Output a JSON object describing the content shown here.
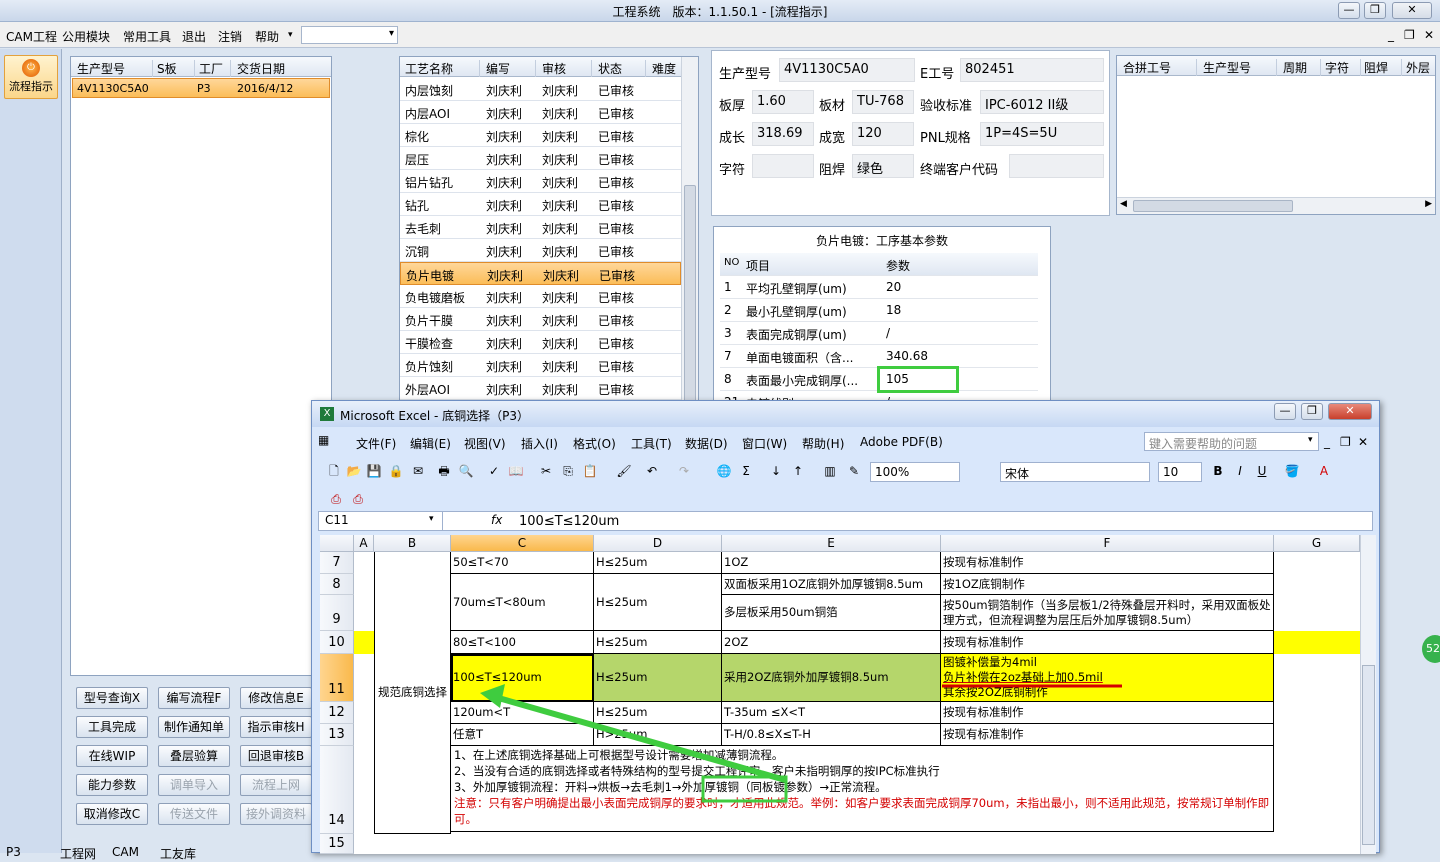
{
  "window": {
    "title": "工程系统　版本：1.1.50.1 - [流程指示]"
  },
  "menu": {
    "items": [
      "CAM工程",
      "公用模块",
      "常用工具",
      "退出",
      "注销",
      "帮助"
    ]
  },
  "nav": {
    "flow_label": "流程指示"
  },
  "orders": {
    "headers": [
      "生产型号",
      "S板",
      "工厂",
      "交货日期"
    ],
    "rows": [
      {
        "model": "4V1130C5A0",
        "s": "",
        "factory": "P3",
        "date": "2016/4/12"
      }
    ]
  },
  "process": {
    "headers": [
      "工艺名称",
      "编写",
      "审核",
      "状态",
      "难度"
    ],
    "rows": [
      [
        "内层蚀刻",
        "刘庆利",
        "刘庆利",
        "已审核"
      ],
      [
        "内层AOI",
        "刘庆利",
        "刘庆利",
        "已审核"
      ],
      [
        "棕化",
        "刘庆利",
        "刘庆利",
        "已审核"
      ],
      [
        "层压",
        "刘庆利",
        "刘庆利",
        "已审核"
      ],
      [
        "铝片钻孔",
        "刘庆利",
        "刘庆利",
        "已审核"
      ],
      [
        "钻孔",
        "刘庆利",
        "刘庆利",
        "已审核"
      ],
      [
        "去毛刺",
        "刘庆利",
        "刘庆利",
        "已审核"
      ],
      [
        "沉铜",
        "刘庆利",
        "刘庆利",
        "已审核"
      ],
      [
        "负片电镀",
        "刘庆利",
        "刘庆利",
        "已审核"
      ],
      [
        "负电镀磨板",
        "刘庆利",
        "刘庆利",
        "已审核"
      ],
      [
        "负片干膜",
        "刘庆利",
        "刘庆利",
        "已审核"
      ],
      [
        "干膜检查",
        "刘庆利",
        "刘庆利",
        "已审核"
      ],
      [
        "负片蚀刻",
        "刘庆利",
        "刘庆利",
        "已审核"
      ],
      [
        "外层AOI",
        "刘庆利",
        "刘庆利",
        "已审核"
      ]
    ]
  },
  "info": {
    "model_label": "生产型号",
    "model": "4V1130C5A0",
    "eno_label": "E工号",
    "eno": "802451",
    "thick_label": "板厚",
    "thick": "1.60",
    "mat_label": "板材",
    "mat": "TU-768",
    "std_label": "验收标准",
    "std": "IPC-6012 II级",
    "len_label": "成长",
    "len": "318.69",
    "wid_label": "成宽",
    "wid": "120",
    "pnl_label": "PNL规格",
    "pnl": "1P=4S=5U",
    "char_label": "字符",
    "char": "",
    "mask_label": "阻焊",
    "mask": "绿色",
    "cust_label": "终端客户代码",
    "cust": ""
  },
  "panels": {
    "headers": [
      "合拼工号",
      "生产型号",
      "周期",
      "字符",
      "阻焊",
      "外层"
    ]
  },
  "param": {
    "title": "负片电镀：工序基本参数",
    "headers": [
      "NO",
      "项目",
      "参数"
    ],
    "rows": [
      [
        "1",
        "平均孔壁铜厚(um)",
        "20"
      ],
      [
        "2",
        "最小孔壁铜厚(um)",
        "18"
      ],
      [
        "3",
        "表面完成铜厚(um)",
        "/"
      ],
      [
        "7",
        "单面电镀面积（含...",
        "340.68"
      ],
      [
        "8",
        "表面最小完成铜厚(...",
        "105"
      ],
      [
        "21",
        "电镀线别",
        "/"
      ]
    ]
  },
  "buttons": {
    "row1": [
      "型号查询X",
      "编写流程F",
      "修改信息E"
    ],
    "row2": [
      "工具完成",
      "制作通知单",
      "指示审核H"
    ],
    "row3": [
      "在线WIP",
      "叠层验算",
      "回退审核B"
    ],
    "row4": [
      "能力参数",
      "调单导入",
      "流程上网"
    ],
    "row5": [
      "取消修改C",
      "传送文件",
      "接外调资料"
    ]
  },
  "status_tabs": [
    "P3",
    "工程网",
    "CAM",
    "工友库"
  ],
  "excel": {
    "title": "Microsoft Excel - 底铜选择（P3）",
    "menu": [
      "文件(F)",
      "编辑(E)",
      "视图(V)",
      "插入(I)",
      "格式(O)",
      "工具(T)",
      "数据(D)",
      "窗口(W)",
      "帮助(H)",
      "Adobe PDF(B)"
    ],
    "help_placeholder": "键入需要帮助的问题",
    "zoom": "100%",
    "font": "宋体",
    "font_size": "10",
    "name_box": "C11",
    "formula": "100≤T≤120um",
    "columns": [
      "A",
      "B",
      "C",
      "D",
      "E",
      "F",
      "G"
    ],
    "row_numbers": [
      "7",
      "8",
      "9",
      "10",
      "11",
      "12",
      "13",
      "14",
      "15"
    ],
    "b_label": "规范底铜选择",
    "cells": {
      "c7": "50≤T<70",
      "d7": "H≤25um",
      "e7": "1OZ",
      "f7": "按现有标准制作",
      "e8": "双面板采用1OZ底铜外加厚镀铜8.5um",
      "f8": "按1OZ底铜制作",
      "c9": "70um≤T<80um",
      "d9": "H≤25um",
      "e9": "多层板采用50um铜箔",
      "f9": "按50um铜箔制作（当多层板1/2待殊叠层开料时，采用双面板处理方式，但流程调整为层压后外加厚镀铜8.5um）",
      "c10": "80≤T<100",
      "d10": "H≤25um",
      "e10": "2OZ",
      "f10": "按现有标准制作",
      "c11": "100≤T≤120um",
      "d11": "H≤25um",
      "e11": "采用2OZ底铜外加厚镀铜8.5um",
      "f11a": "图镀补偿量为4mil",
      "f11b": "负片补偿在2oz基础上加0.5mil",
      "f11c": "其余按2OZ底铜制作",
      "c12": "120um<T",
      "d12": "H≤25um",
      "e12": "T-35um ≤X<T",
      "f12": "按现有标准制作",
      "c13": "任意T",
      "d13": "H>25um",
      "e13": "T-H/0.8≤X≤T-H",
      "f13": "按现有标准制作"
    },
    "notes": [
      "1、在上述底铜选择基础上可根据型号设计需要增加减薄铜流程。",
      "2、当没有合适的底铜选择或者特殊结构的型号提交工程评审，客户未指明铜厚的按IPC标准执行",
      "3、外加厚镀铜流程：开料→烘板→去毛刺1→外加厚镀铜（同板镀参数）→正常流程。",
      "注意：只有客户明确提出最小表面完成铜厚的要求时，才适用此规范。举例：如客户要求表面完成铜厚70um，未指出最小，则不适用此规范，按常规订单制作即可。"
    ]
  },
  "side_badge": "52",
  "colors": {
    "accent": "#fbbd58",
    "highlight_yellow": "#ffff00",
    "highlight_green": "#b5d66b",
    "arrow_green": "#3fcc3f",
    "note_red": "#d40000"
  }
}
